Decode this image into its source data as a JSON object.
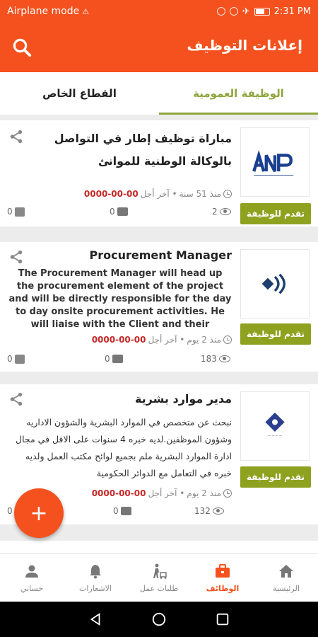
{
  "status_bar": {
    "left_text": "Airplane mode",
    "time": "2:31 PM"
  },
  "app_bar": {
    "title": "إعلانات التوظيف",
    "search_icon": "search-icon"
  },
  "tabs": [
    {
      "label": "الوظيفة العمومية",
      "active": true
    },
    {
      "label": "القطاع الخاص",
      "active": false
    }
  ],
  "jobs": [
    {
      "title": "مباراة توظيف إطار في التواصل بالوكالة الوطنية للموانئ",
      "description": "",
      "posted": "منذ 51 سنة",
      "deadline_label": "• آخر أجل",
      "deadline": "0000-00-00",
      "views": "2",
      "comments": "0",
      "likes": "0",
      "apply_label": "تقدم للوظيفة",
      "logo": "ANP"
    },
    {
      "title": "Procurement Manager",
      "description": "The Procurement Manager will head up the procurement element of the project and will be directly responsible for the day to day onsite procurement activities. He will liaise with the Client and their",
      "posted": "منذ 2 يوم",
      "deadline_label": "• آخر أجل",
      "deadline": "0000-00-00",
      "views": "183",
      "comments": "0",
      "likes": "0",
      "apply_label": "تقدم للوظيفة",
      "logo": ""
    },
    {
      "title": "مدير موارد بشرية",
      "description": "نبحث عن متخصص في الموارد البشرية والشؤون الاداريه وشؤون الموظفين.لديه خبره 4 سنوات على الاقل في مجال ادارة الموارد البشرية ملم بجميع لوائح مكتب العمل ولديه خبره في التعامل مع الدوائر الحكومية",
      "posted": "منذ 2 يوم",
      "deadline_label": "• آخر أجل",
      "deadline": "0000-00-00",
      "views": "132",
      "comments": "0",
      "likes": "0",
      "apply_label": "تقدم للوظيفة",
      "logo": ""
    }
  ],
  "fab": {
    "label": "+"
  },
  "bottom_nav": [
    {
      "label": "الرئيسية",
      "icon": "home-icon",
      "active": false
    },
    {
      "label": "الوظائف",
      "icon": "briefcase-icon",
      "active": true
    },
    {
      "label": "طلبات عمل",
      "icon": "worker-icon",
      "active": false
    },
    {
      "label": "الاشعارات",
      "icon": "bell-icon",
      "active": false
    },
    {
      "label": "حسابي",
      "icon": "person-icon",
      "active": false
    }
  ],
  "colors": {
    "primary": "#f4511e",
    "accent": "#8fa21f",
    "deadline": "#c62828"
  }
}
